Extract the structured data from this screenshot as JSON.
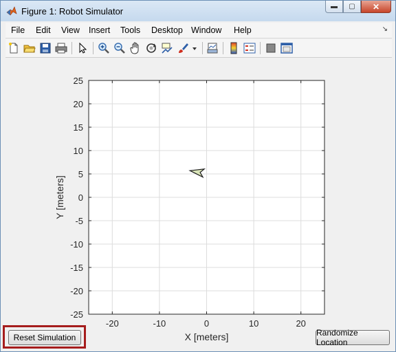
{
  "window": {
    "title": "Figure 1: Robot Simulator",
    "controls": {
      "minimize": "▬",
      "maximize": "▢",
      "close": "✕"
    }
  },
  "menu": [
    "File",
    "Edit",
    "View",
    "Insert",
    "Tools",
    "Desktop",
    "Window",
    "Help"
  ],
  "menu_dock": "↘",
  "toolbar": {
    "icons": [
      "new-figure-icon",
      "open-file-icon",
      "save-icon",
      "print-icon",
      "pointer-icon",
      "zoom-in-icon",
      "zoom-out-icon",
      "pan-hand-icon",
      "rotate-3d-icon",
      "data-cursor-icon",
      "brush-icon",
      "link-plot-icon",
      "colorbar-icon",
      "legend-icon",
      "hide-plot-tools-icon",
      "show-plot-tools-icon"
    ]
  },
  "chart_data": {
    "type": "scatter",
    "xlabel": "X [meters]",
    "ylabel": "Y [meters]",
    "xlim": [
      -25,
      25
    ],
    "ylim": [
      -25,
      25
    ],
    "xticks": [
      -20,
      -10,
      0,
      10,
      20
    ],
    "yticks": [
      25,
      20,
      15,
      10,
      5,
      0,
      -5,
      -10,
      -15,
      -20,
      -25
    ],
    "grid": true,
    "robot": {
      "x": -1.8,
      "y": 5.4,
      "heading_deg": 170,
      "fill": "#d9e4b8",
      "stroke": "#1a1a1a"
    }
  },
  "buttons": {
    "reset": "Reset Simulation",
    "randomize": "Randomize Location"
  },
  "colors": {
    "highlight": "#a51c1c",
    "grid": "#dcdcdc"
  }
}
